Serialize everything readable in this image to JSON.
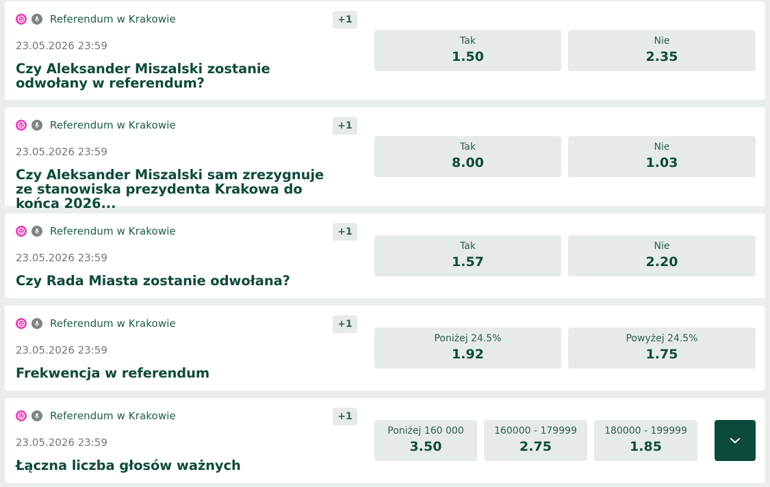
{
  "markets": [
    {
      "league": "Referendum w Krakowie",
      "more": "+1",
      "datetime": "23.05.2026 23:59",
      "title": "Czy Aleksander Miszalski zostanie odwołany w referendum?",
      "odds": [
        {
          "label": "Tak",
          "value": "1.50"
        },
        {
          "label": "Nie",
          "value": "2.35"
        }
      ]
    },
    {
      "league": "Referendum w Krakowie",
      "more": "+1",
      "datetime": "23.05.2026 23:59",
      "title": "Czy Aleksander Miszalski sam zrezygnuje ze stanowiska prezydenta Krakowa do końca 2026...",
      "odds": [
        {
          "label": "Tak",
          "value": "8.00"
        },
        {
          "label": "Nie",
          "value": "1.03"
        }
      ]
    },
    {
      "league": "Referendum w Krakowie",
      "more": "+1",
      "datetime": "23.05.2026 23:59",
      "title": "Czy Rada Miasta zostanie odwołana?",
      "odds": [
        {
          "label": "Tak",
          "value": "1.57"
        },
        {
          "label": "Nie",
          "value": "2.20"
        }
      ]
    },
    {
      "league": "Referendum w Krakowie",
      "more": "+1",
      "datetime": "23.05.2026 23:59",
      "title": "Frekwencja w referendum",
      "odds": [
        {
          "label": "Poniżej 24.5%",
          "value": "1.92"
        },
        {
          "label": "Powyżej 24.5%",
          "value": "1.75"
        }
      ]
    },
    {
      "league": "Referendum w Krakowie",
      "more": "+1",
      "datetime": "23.05.2026 23:59",
      "title": "Łączna liczba głosów ważnych",
      "odds": [
        {
          "label": "Poniżej 160 000",
          "value": "3.50"
        },
        {
          "label": "160000 - 179999",
          "value": "2.75"
        },
        {
          "label": "180000 - 199999",
          "value": "1.85"
        }
      ]
    }
  ],
  "icons": {
    "category": "politics-icon",
    "media": "microphone-icon",
    "expand": "chevron-down-icon"
  },
  "colors": {
    "background": "#e9edeb",
    "card": "#ffffff",
    "odds_button": "#e6ebe9",
    "text_primary": "#0f4a3c",
    "category_icon": "#e63fb7",
    "expand_button": "#0c4a3b"
  }
}
